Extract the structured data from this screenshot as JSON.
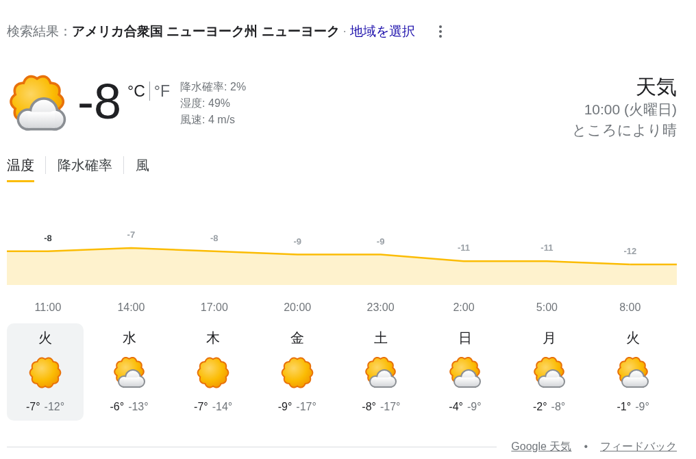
{
  "header": {
    "prefix": "検索結果：",
    "location": "アメリカ合衆国 ニューヨーク州 ニューヨーク",
    "separator": "·",
    "region_link": "地域を選択"
  },
  "current": {
    "kind": "partly_cloudy",
    "temperature": "-8",
    "units": [
      {
        "label": "°C",
        "selected": true
      },
      {
        "label": "°F",
        "selected": false
      }
    ],
    "details": [
      "降水確率: 2%",
      "湿度: 49%",
      "風速: 4 m/s"
    ]
  },
  "summary": {
    "title": "天気",
    "time": "10:00 (火曜日)",
    "condition": "ところにより晴"
  },
  "tabs": [
    {
      "label": "温度",
      "selected": true
    },
    {
      "label": "降水確率",
      "selected": false
    },
    {
      "label": "風",
      "selected": false
    }
  ],
  "hourly": {
    "chart_data": {
      "type": "area",
      "categories": [
        "11:00",
        "14:00",
        "17:00",
        "20:00",
        "23:00",
        "2:00",
        "5:00",
        "8:00"
      ],
      "series": [
        {
          "color": "#fbbc04",
          "values": [
            -8,
            -7,
            -8,
            -9,
            -9,
            -11,
            -11,
            -12
          ]
        }
      ],
      "data_labels": true
    }
  },
  "days": [
    {
      "day": "火",
      "kind": "sunny",
      "high": "-7°",
      "low": "-12°",
      "selected": true
    },
    {
      "day": "水",
      "kind": "partly_cloudy",
      "high": "-6°",
      "low": "-13°",
      "selected": false
    },
    {
      "day": "木",
      "kind": "sunny",
      "high": "-7°",
      "low": "-14°",
      "selected": false
    },
    {
      "day": "金",
      "kind": "sunny",
      "high": "-9°",
      "low": "-17°",
      "selected": false
    },
    {
      "day": "土",
      "kind": "partly_cloudy",
      "high": "-8°",
      "low": "-17°",
      "selected": false
    },
    {
      "day": "日",
      "kind": "partly_cloudy",
      "high": "-4°",
      "low": "-9°",
      "selected": false
    },
    {
      "day": "月",
      "kind": "partly_cloudy",
      "high": "-2°",
      "low": "-8°",
      "selected": false
    },
    {
      "day": "火",
      "kind": "partly_cloudy",
      "high": "-1°",
      "low": "-9°",
      "selected": false
    }
  ],
  "footer": {
    "source_link": "Google 天気",
    "separator": "•",
    "feedback_link": "フィードバック"
  }
}
